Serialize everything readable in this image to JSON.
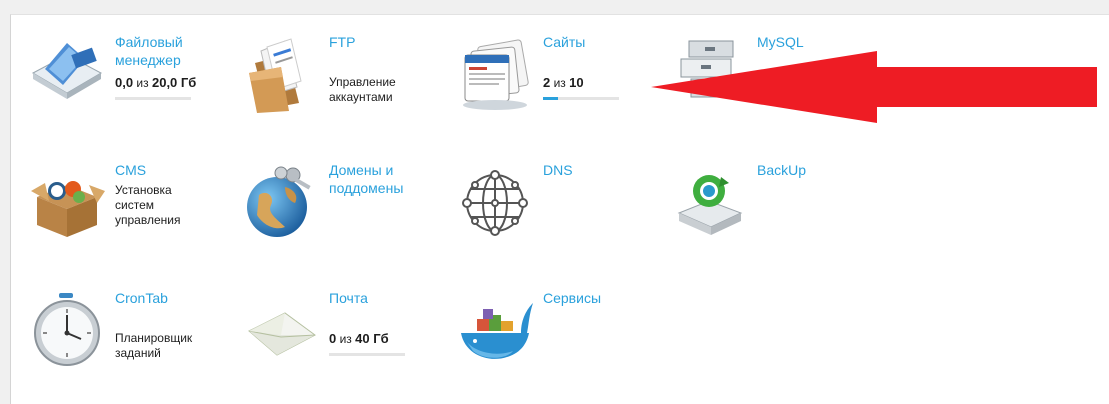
{
  "colors": {
    "link": "#2aa1dc",
    "text": "#1d1d1d",
    "bar_track": "#e4e4e4",
    "bar_fill": "#2aa1dc",
    "arrow": "#ee1c24"
  },
  "tiles": {
    "files": {
      "title_lines": [
        "Файловый",
        "менеджер"
      ],
      "used": "0,0",
      "of": "из",
      "total": "20,0 Гб",
      "fraction": 0.0,
      "icon": "file-manager-icon"
    },
    "ftp": {
      "title": "FTP",
      "desc_lines": [
        "Управление",
        "аккаунтами"
      ],
      "icon": "ftp-icon"
    },
    "sites": {
      "title": "Сайты",
      "used": "2",
      "of": "из",
      "total": "10",
      "fraction": 0.2,
      "icon": "sites-icon"
    },
    "mysql": {
      "title": "MySQL",
      "icon": "mysql-icon"
    },
    "cms": {
      "title": "CMS",
      "desc_lines": [
        "Установка",
        "систем",
        "управления"
      ],
      "icon": "cms-box-icon"
    },
    "domains": {
      "title_lines": [
        "Домены и",
        "поддомены"
      ],
      "icon": "domains-globe-icon"
    },
    "dns": {
      "title": "DNS",
      "icon": "dns-network-icon"
    },
    "backup": {
      "title": "BackUp",
      "icon": "backup-drive-icon"
    },
    "crontab": {
      "title": "CronTab",
      "desc_lines": [
        "Планировщик",
        "заданий"
      ],
      "icon": "clock-icon"
    },
    "mail": {
      "title": "Почта",
      "used": "0",
      "of": "из",
      "total": "40 Гб",
      "fraction": 0.0,
      "icon": "mail-envelope-icon"
    },
    "services": {
      "title": "Сервисы",
      "icon": "services-whale-icon"
    }
  }
}
